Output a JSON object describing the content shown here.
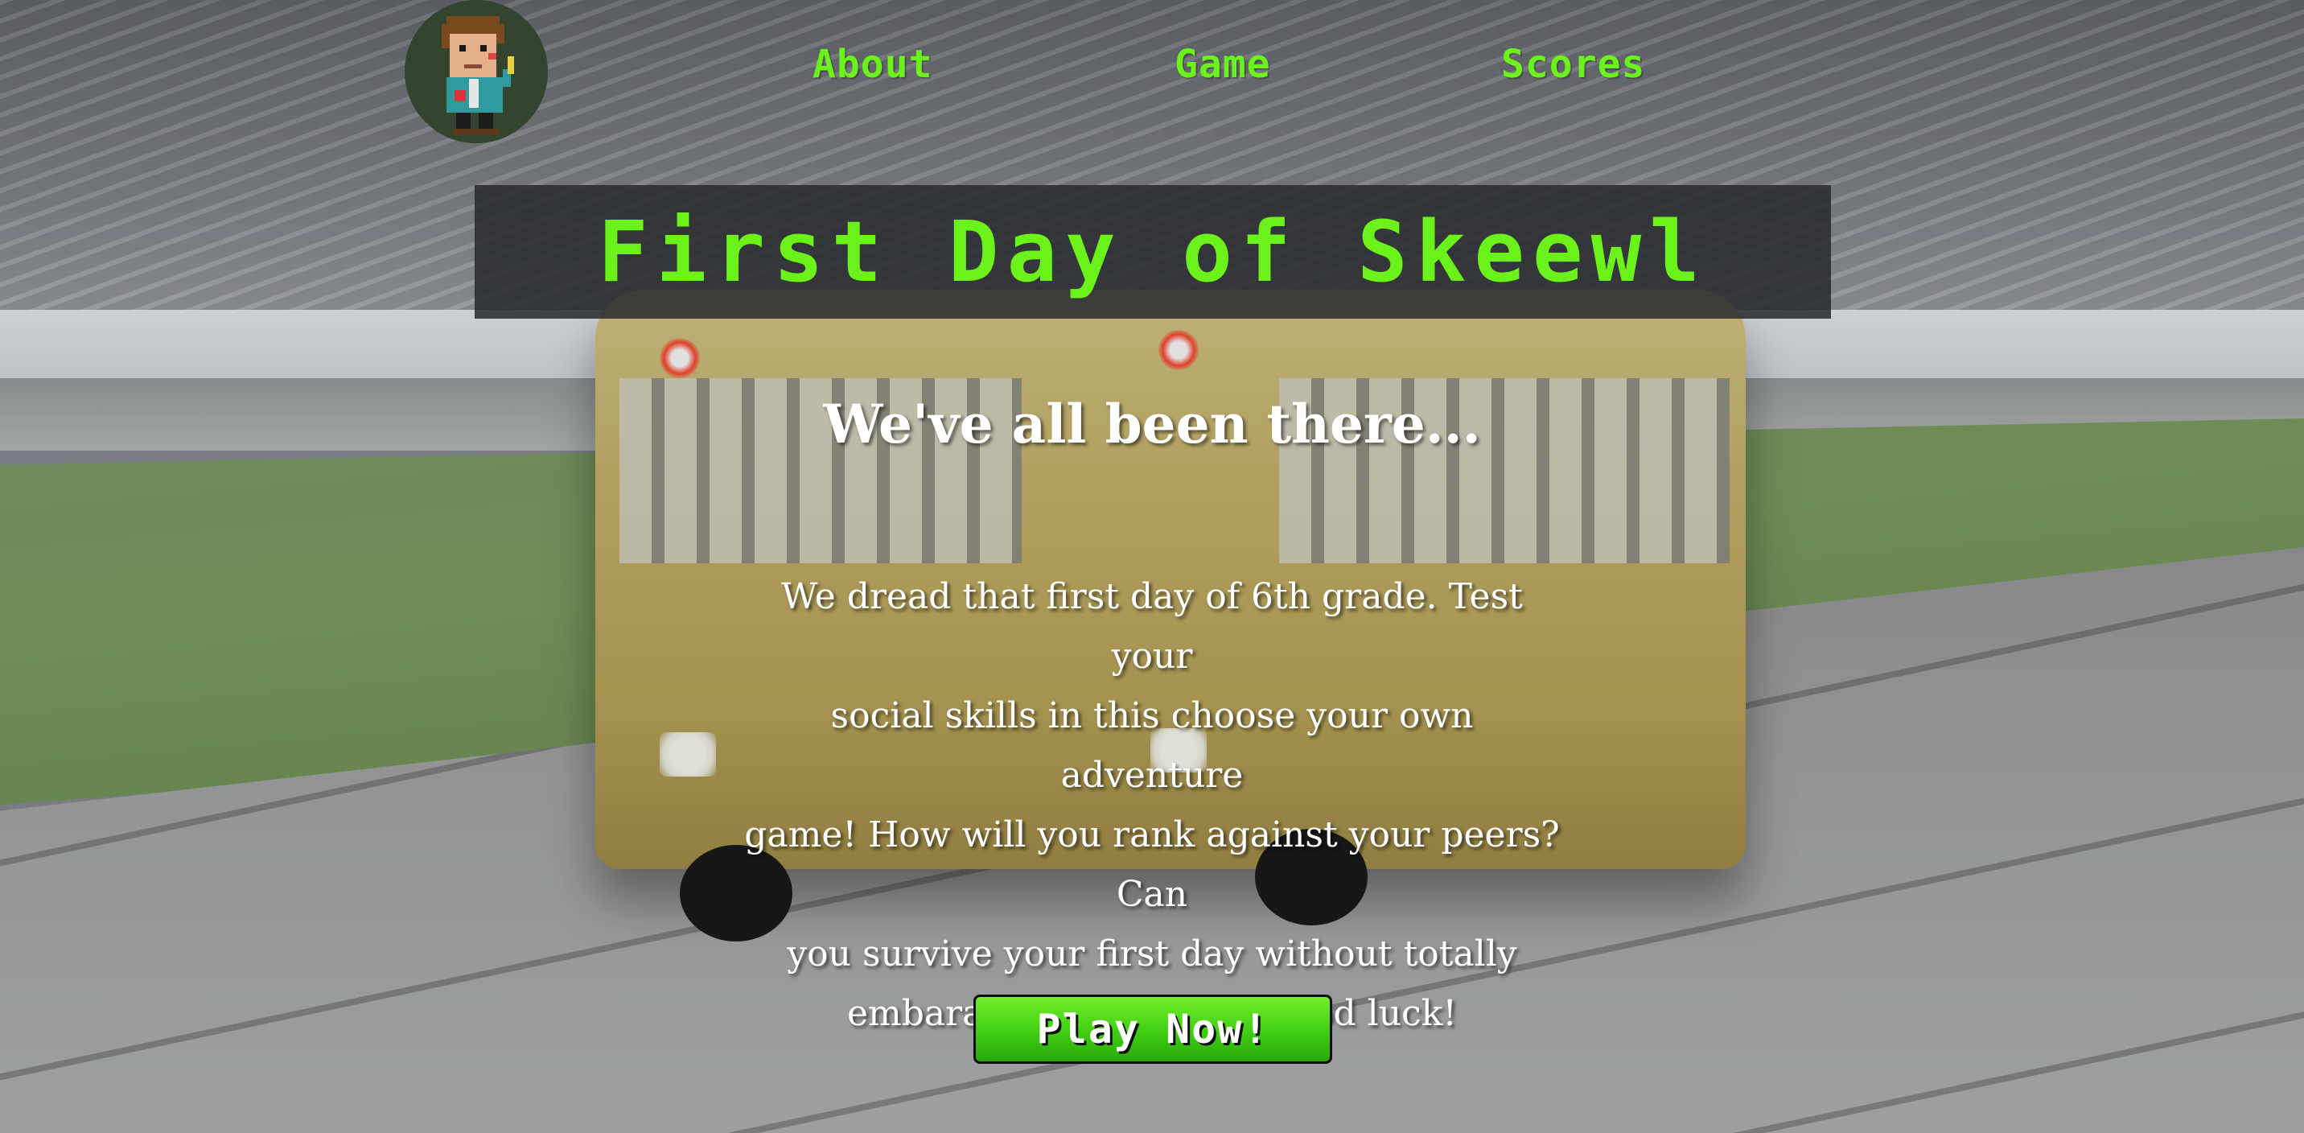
{
  "header": {
    "logo_icon": "pixel-student-avatar-icon",
    "nav": [
      {
        "label": "About"
      },
      {
        "label": "Game"
      },
      {
        "label": "Scores"
      }
    ]
  },
  "hero": {
    "title": "First Day of Skeewl",
    "subtitle": "We've all been there...",
    "description_lines": [
      "We dread that first day of 6th grade. Test your",
      "social skills in this choose your own adventure",
      "game! How will you rank against your peers? Can",
      "you survive your first day without totally",
      "embarassing yourself? Good luck!"
    ],
    "cta_label": "Play Now!"
  },
  "colors": {
    "accent_green": "#6bf21a",
    "button_green": "#3fce12",
    "title_box": "#282a2c"
  }
}
